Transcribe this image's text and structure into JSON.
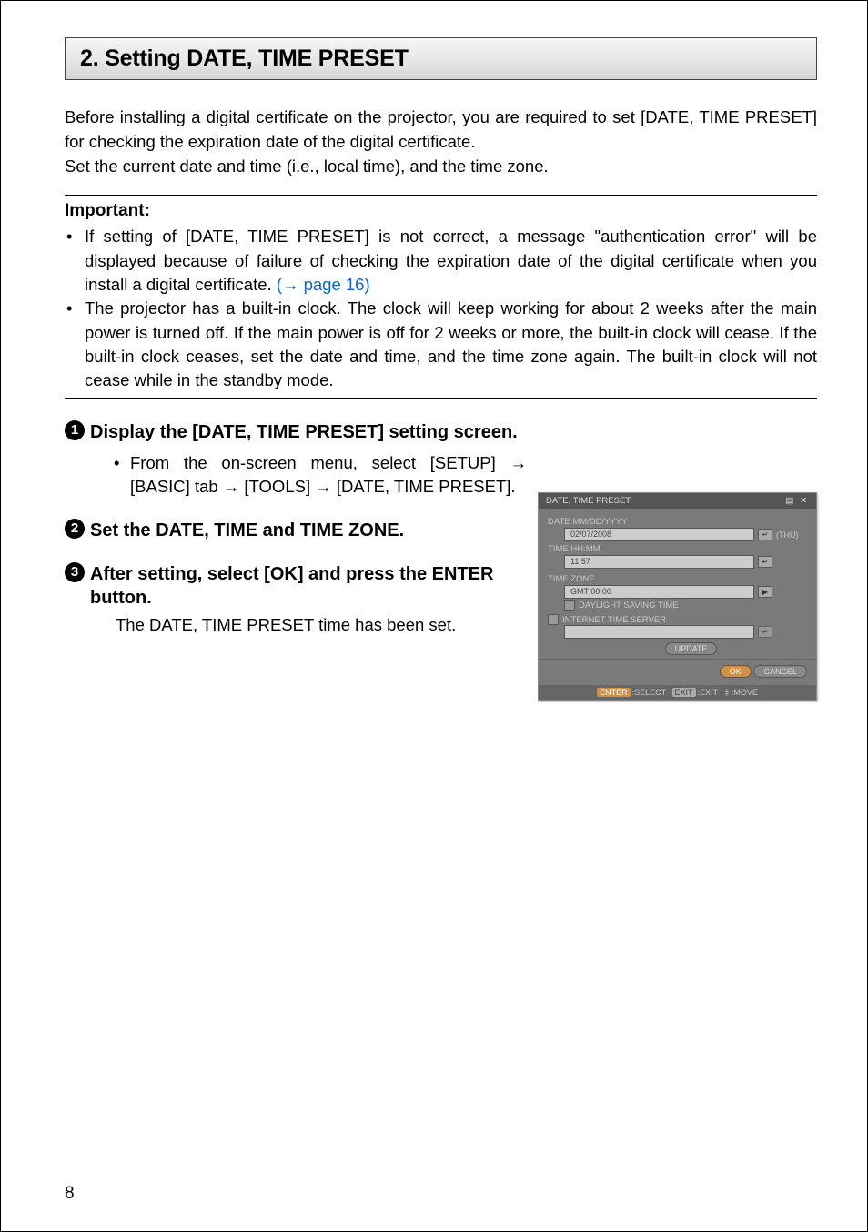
{
  "header": {
    "title": "2. Setting DATE, TIME PRESET"
  },
  "intro": {
    "p1": "Before installing a digital certificate on the projector, you are required to set [DATE, TIME PRESET] for checking the expiration date of the digital certificate.",
    "p2": "Set the current date and time (i.e., local time), and the time zone."
  },
  "important": {
    "label": "Important:",
    "b1_a": "If setting of [DATE, TIME PRESET] is not correct, a message \"authentication error\" will be displayed because of failure of checking the expiration date of the digital certificate when you install a digital certificate. ",
    "b1_link": "(→ page 16)",
    "b2": "The projector has a built-in clock. The clock will keep working for about 2 weeks after the main power is turned off. If the main power is off for 2 weeks or more, the built-in clock will cease. If the built-in clock ceases, set the date and time, and the time zone  again. The built-in clock will not cease while in the standby mode."
  },
  "steps": {
    "s1": {
      "num": "1",
      "title": "Display the [DATE, TIME PRESET] setting screen.",
      "sub": "From the on-screen menu, select [SETUP] → [BASIC] tab → [TOOLS] → [DATE, TIME PRESET]."
    },
    "s2": {
      "num": "2",
      "title": "Set the DATE, TIME and TIME ZONE."
    },
    "s3": {
      "num": "3",
      "title": "After setting, select [OK] and press the ENTER button.",
      "desc": "The DATE, TIME PRESET time has been set."
    }
  },
  "screenshot": {
    "title": "DATE, TIME PRESET",
    "date_label": "DATE MM/DD/YYYY",
    "date_value": "02/07/2008",
    "weekday": "(THU)",
    "time_label": "TIME HH:MM",
    "time_value": "11:57",
    "tz_label": "TIME ZONE",
    "tz_value": "GMT 00:00",
    "dst": "DAYLIGHT SAVING TIME",
    "its": "INTERNET TIME SERVER",
    "update": "UPDATE",
    "ok": "OK",
    "cancel": "CANCEL",
    "footer_enter": "ENTER",
    "footer_select": ":SELECT",
    "footer_exit": "EXIT",
    "footer_exit_t": ":EXIT",
    "footer_move": "‡ :MOVE"
  },
  "page_number": "8"
}
